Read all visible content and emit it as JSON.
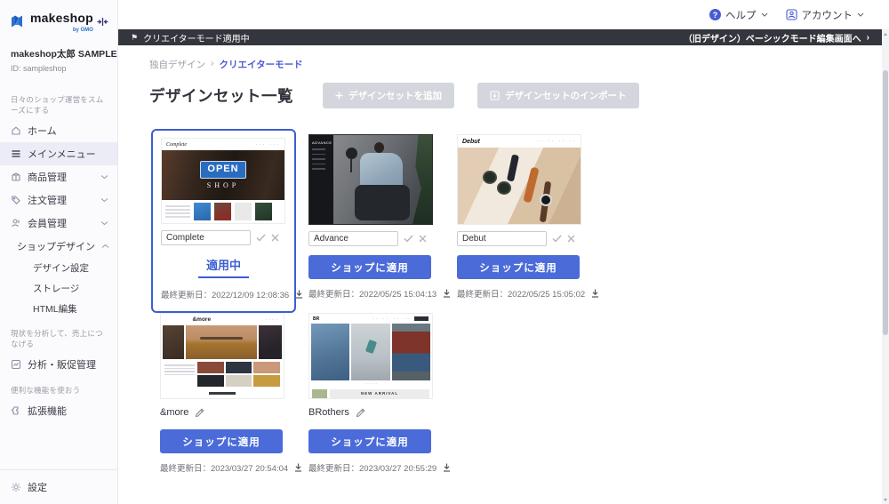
{
  "brand": {
    "name": "makeshop",
    "byline": "by GMO"
  },
  "sidebar": {
    "shop_name": "makeshop太郎 SAMPLE",
    "shop_id": "ID: sampleshop",
    "sections": {
      "daily": "日々のショップ運営をスムーズにする",
      "analyze": "現状を分析して、売上につなげる",
      "useful": "便利な機能を使おう"
    },
    "items": [
      {
        "label": "ホーム"
      },
      {
        "label": "メインメニュー"
      },
      {
        "label": "商品管理"
      },
      {
        "label": "注文管理"
      },
      {
        "label": "会員管理"
      },
      {
        "label": "ショップデザイン"
      }
    ],
    "subitems": [
      {
        "label": "デザイン設定"
      },
      {
        "label": "ストレージ"
      },
      {
        "label": "HTML編集"
      }
    ],
    "analytics": "分析・販促管理",
    "extensions": "拡張機能",
    "settings": "設定"
  },
  "header": {
    "help": "ヘルプ",
    "help_icon": "?",
    "account": "アカウント"
  },
  "modebar": {
    "status": "クリエイターモード適用中",
    "flag": "⚑",
    "link": "（旧デザイン）ベーシックモード編集画面へ",
    "chevron": "›"
  },
  "breadcrumb": {
    "parent": "独自デザイン",
    "separator": "›",
    "current": "クリエイターモード"
  },
  "page": {
    "title": "デザインセット一覧",
    "add_button": "デザインセットを追加",
    "import_button": "デザインセットのインポート"
  },
  "cards": [
    {
      "name": "Complete",
      "status_label": "適用中",
      "updated": "最終更新日：2022/12/09 12:08:36",
      "thumb": {
        "logo": "Complete",
        "open": "OPEN",
        "shop": "SHOP"
      }
    },
    {
      "name": "Advance",
      "apply_label": "ショップに適用",
      "updated": "最終更新日：2022/05/25 15:04:13",
      "thumb": {
        "logo": "ADVANCE"
      }
    },
    {
      "name": "Debut",
      "apply_label": "ショップに適用",
      "updated": "最終更新日：2022/05/25 15:05:02",
      "thumb": {
        "logo": "Debut"
      }
    },
    {
      "name": "&more",
      "apply_label": "ショップに適用",
      "updated": "最終更新日：2023/03/27 20:54:04",
      "thumb": {
        "logo": "&more"
      }
    },
    {
      "name": "BRothers",
      "apply_label": "ショップに適用",
      "updated": "最終更新日：2023/03/27 20:55:29",
      "thumb": {
        "logo": "BR",
        "banner": "NEW ARRIVAL"
      }
    }
  ],
  "colors": {
    "accent": "#4b6bd9",
    "selected_border": "#3d5ed1",
    "dark_bar": "#33363c"
  }
}
